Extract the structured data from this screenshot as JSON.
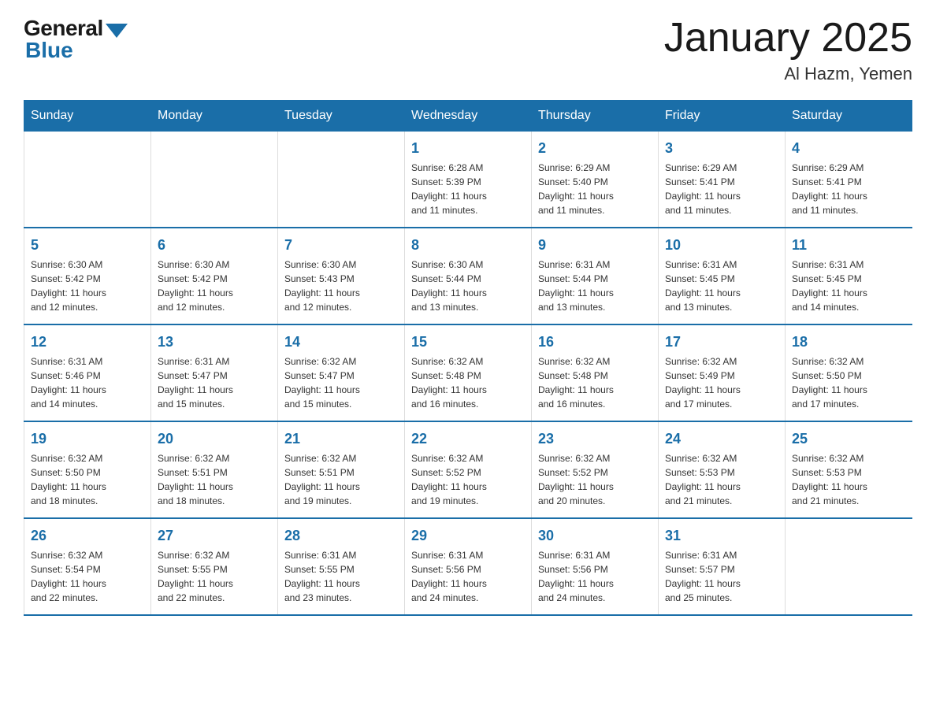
{
  "header": {
    "logo_general": "General",
    "logo_blue": "Blue",
    "month_title": "January 2025",
    "location": "Al Hazm, Yemen"
  },
  "weekdays": [
    "Sunday",
    "Monday",
    "Tuesday",
    "Wednesday",
    "Thursday",
    "Friday",
    "Saturday"
  ],
  "weeks": [
    [
      {
        "day": "",
        "info": ""
      },
      {
        "day": "",
        "info": ""
      },
      {
        "day": "",
        "info": ""
      },
      {
        "day": "1",
        "info": "Sunrise: 6:28 AM\nSunset: 5:39 PM\nDaylight: 11 hours\nand 11 minutes."
      },
      {
        "day": "2",
        "info": "Sunrise: 6:29 AM\nSunset: 5:40 PM\nDaylight: 11 hours\nand 11 minutes."
      },
      {
        "day": "3",
        "info": "Sunrise: 6:29 AM\nSunset: 5:41 PM\nDaylight: 11 hours\nand 11 minutes."
      },
      {
        "day": "4",
        "info": "Sunrise: 6:29 AM\nSunset: 5:41 PM\nDaylight: 11 hours\nand 11 minutes."
      }
    ],
    [
      {
        "day": "5",
        "info": "Sunrise: 6:30 AM\nSunset: 5:42 PM\nDaylight: 11 hours\nand 12 minutes."
      },
      {
        "day": "6",
        "info": "Sunrise: 6:30 AM\nSunset: 5:42 PM\nDaylight: 11 hours\nand 12 minutes."
      },
      {
        "day": "7",
        "info": "Sunrise: 6:30 AM\nSunset: 5:43 PM\nDaylight: 11 hours\nand 12 minutes."
      },
      {
        "day": "8",
        "info": "Sunrise: 6:30 AM\nSunset: 5:44 PM\nDaylight: 11 hours\nand 13 minutes."
      },
      {
        "day": "9",
        "info": "Sunrise: 6:31 AM\nSunset: 5:44 PM\nDaylight: 11 hours\nand 13 minutes."
      },
      {
        "day": "10",
        "info": "Sunrise: 6:31 AM\nSunset: 5:45 PM\nDaylight: 11 hours\nand 13 minutes."
      },
      {
        "day": "11",
        "info": "Sunrise: 6:31 AM\nSunset: 5:45 PM\nDaylight: 11 hours\nand 14 minutes."
      }
    ],
    [
      {
        "day": "12",
        "info": "Sunrise: 6:31 AM\nSunset: 5:46 PM\nDaylight: 11 hours\nand 14 minutes."
      },
      {
        "day": "13",
        "info": "Sunrise: 6:31 AM\nSunset: 5:47 PM\nDaylight: 11 hours\nand 15 minutes."
      },
      {
        "day": "14",
        "info": "Sunrise: 6:32 AM\nSunset: 5:47 PM\nDaylight: 11 hours\nand 15 minutes."
      },
      {
        "day": "15",
        "info": "Sunrise: 6:32 AM\nSunset: 5:48 PM\nDaylight: 11 hours\nand 16 minutes."
      },
      {
        "day": "16",
        "info": "Sunrise: 6:32 AM\nSunset: 5:48 PM\nDaylight: 11 hours\nand 16 minutes."
      },
      {
        "day": "17",
        "info": "Sunrise: 6:32 AM\nSunset: 5:49 PM\nDaylight: 11 hours\nand 17 minutes."
      },
      {
        "day": "18",
        "info": "Sunrise: 6:32 AM\nSunset: 5:50 PM\nDaylight: 11 hours\nand 17 minutes."
      }
    ],
    [
      {
        "day": "19",
        "info": "Sunrise: 6:32 AM\nSunset: 5:50 PM\nDaylight: 11 hours\nand 18 minutes."
      },
      {
        "day": "20",
        "info": "Sunrise: 6:32 AM\nSunset: 5:51 PM\nDaylight: 11 hours\nand 18 minutes."
      },
      {
        "day": "21",
        "info": "Sunrise: 6:32 AM\nSunset: 5:51 PM\nDaylight: 11 hours\nand 19 minutes."
      },
      {
        "day": "22",
        "info": "Sunrise: 6:32 AM\nSunset: 5:52 PM\nDaylight: 11 hours\nand 19 minutes."
      },
      {
        "day": "23",
        "info": "Sunrise: 6:32 AM\nSunset: 5:52 PM\nDaylight: 11 hours\nand 20 minutes."
      },
      {
        "day": "24",
        "info": "Sunrise: 6:32 AM\nSunset: 5:53 PM\nDaylight: 11 hours\nand 21 minutes."
      },
      {
        "day": "25",
        "info": "Sunrise: 6:32 AM\nSunset: 5:53 PM\nDaylight: 11 hours\nand 21 minutes."
      }
    ],
    [
      {
        "day": "26",
        "info": "Sunrise: 6:32 AM\nSunset: 5:54 PM\nDaylight: 11 hours\nand 22 minutes."
      },
      {
        "day": "27",
        "info": "Sunrise: 6:32 AM\nSunset: 5:55 PM\nDaylight: 11 hours\nand 22 minutes."
      },
      {
        "day": "28",
        "info": "Sunrise: 6:31 AM\nSunset: 5:55 PM\nDaylight: 11 hours\nand 23 minutes."
      },
      {
        "day": "29",
        "info": "Sunrise: 6:31 AM\nSunset: 5:56 PM\nDaylight: 11 hours\nand 24 minutes."
      },
      {
        "day": "30",
        "info": "Sunrise: 6:31 AM\nSunset: 5:56 PM\nDaylight: 11 hours\nand 24 minutes."
      },
      {
        "day": "31",
        "info": "Sunrise: 6:31 AM\nSunset: 5:57 PM\nDaylight: 11 hours\nand 25 minutes."
      },
      {
        "day": "",
        "info": ""
      }
    ]
  ]
}
